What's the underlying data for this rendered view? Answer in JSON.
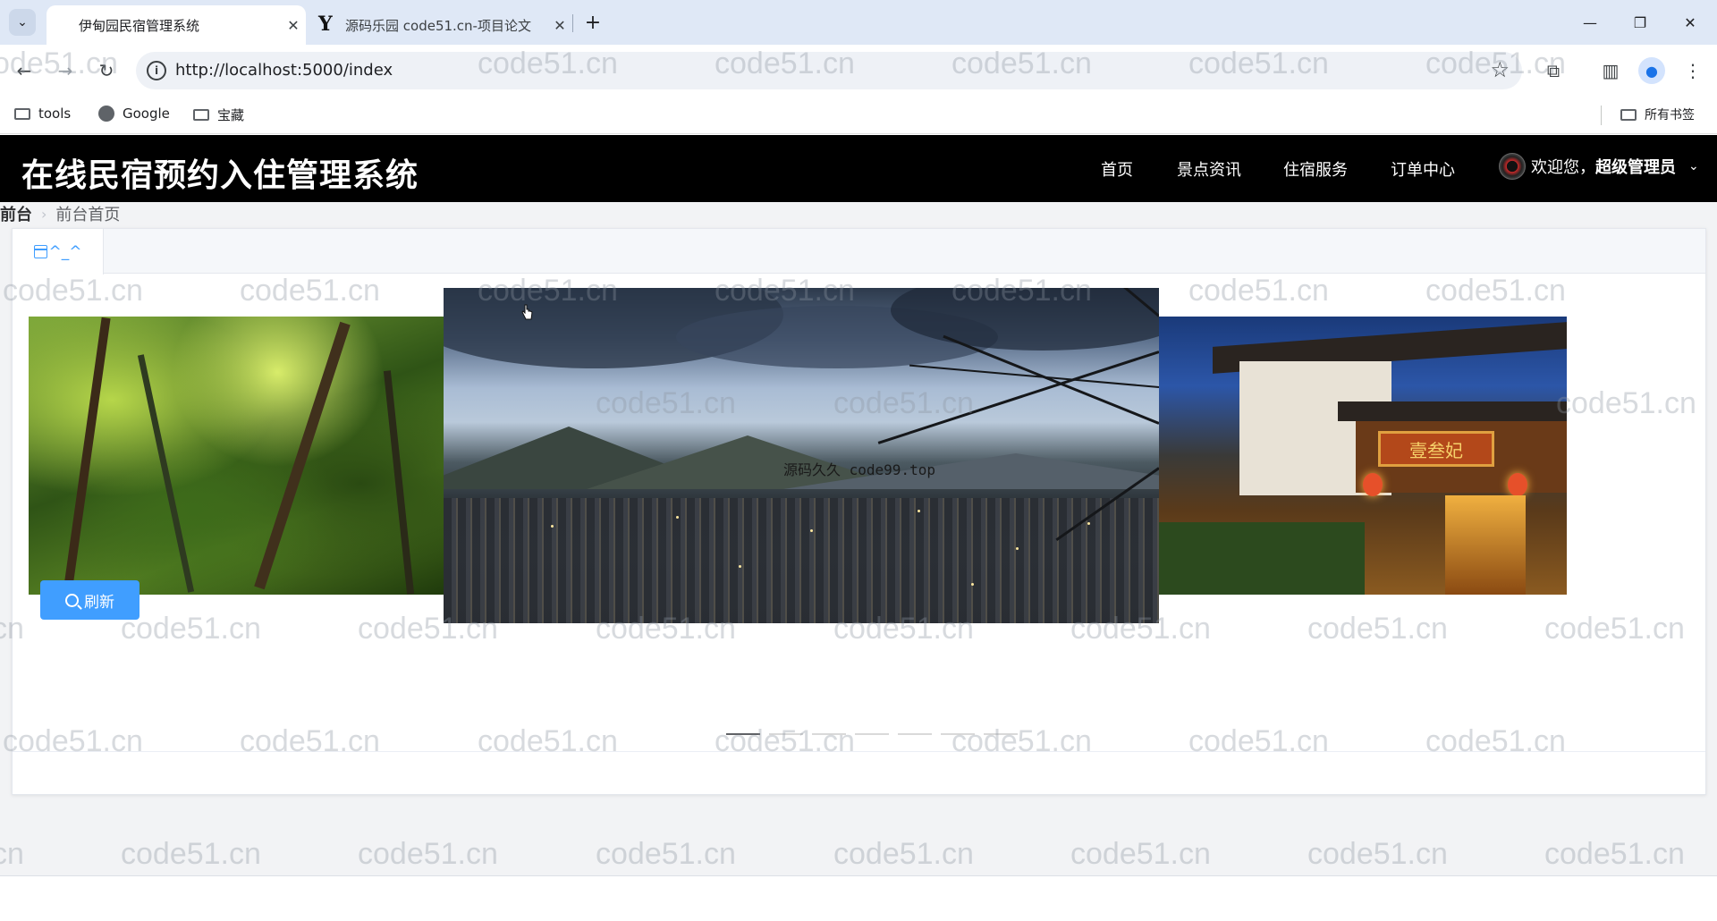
{
  "browser": {
    "tabs": [
      {
        "title": "伊甸园民宿管理系统",
        "active": true
      },
      {
        "title": "源码乐园 code51.cn-项目论文",
        "active": false
      }
    ],
    "url": "http://localhost:5000/index",
    "bookmarks": [
      {
        "label": "tools",
        "icon": "folder-icon"
      },
      {
        "label": "Google",
        "icon": "globe-icon"
      },
      {
        "label": "宝藏",
        "icon": "folder-icon"
      }
    ],
    "all_bookmarks": "所有书签"
  },
  "site": {
    "title": "在线民宿预约入住管理系统",
    "nav": [
      "首页",
      "景点资讯",
      "住宿服务",
      "订单中心"
    ],
    "user": {
      "welcome": "欢迎您，",
      "name": "超级管理员"
    }
  },
  "breadcrumb": [
    "前台",
    "前台首页"
  ],
  "content": {
    "tab_label": "^_^",
    "carousel": {
      "caption": "源码久久 code99.top",
      "sign_text": "壹叁妃",
      "active_index": 0,
      "count": 7
    },
    "refresh_label": "刷新"
  },
  "watermark_text": "code51.cn",
  "colors": {
    "primary": "#409eff",
    "header_bg": "#000000",
    "page_bg": "#f2f3f5"
  }
}
